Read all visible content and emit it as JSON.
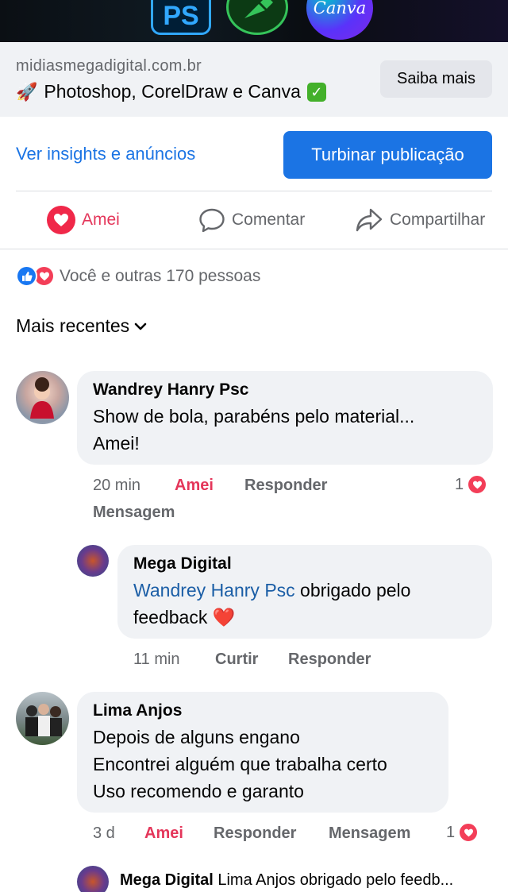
{
  "banner": {
    "app1_label": "PS",
    "app3_label": "Canva"
  },
  "link_preview": {
    "domain": "midiasmegadigital.com.br",
    "rocket_emoji": "🚀",
    "title": "Photoshop, CorelDraw e Canva",
    "check_emoji": "✓",
    "cta_label": "Saiba mais"
  },
  "promo": {
    "insights_label": "Ver insights e anúncios",
    "boost_label": "Turbinar publicação"
  },
  "actions": {
    "reaction_label": "Amei",
    "comment_label": "Comentar",
    "share_label": "Compartilhar"
  },
  "reactions": {
    "summary": "Você e outras 170 pessoas"
  },
  "sort": {
    "label": "Mais recentes"
  },
  "comments": [
    {
      "author": "Wandrey Hanry Psc",
      "text_line1": "Show de bola, parabéns pelo material...",
      "text_line2": "Amei!",
      "time": "20 min",
      "reaction": "Amei",
      "reply": "Responder",
      "message": "Mensagem",
      "reaction_count": "1",
      "replies": [
        {
          "author": "Mega Digital",
          "mention": "Wandrey Hanry Psc",
          "text_after_mention": " obrigado pelo",
          "text_line2": "feedback",
          "heart_emoji": "❤️",
          "time": "11 min",
          "like": "Curtir",
          "reply": "Responder"
        }
      ]
    },
    {
      "author": "Lima Anjos",
      "text_line1": "Depois de alguns engano",
      "text_line2": "Encontrei alguém que trabalha certo",
      "text_line3": "Uso recomendo e garanto",
      "time": "3 d",
      "reaction": "Amei",
      "reply": "Responder",
      "message": "Mensagem",
      "reaction_count": "1",
      "replies": [
        {
          "author": "Mega Digital",
          "preview": "Lima Anjos obrigado pelo feedb..."
        }
      ]
    }
  ],
  "colors": {
    "accent_blue": "#1b74e4",
    "love_red": "#e4365a",
    "bubble_grey": "#f0f2f5",
    "muted_text": "#65676b"
  }
}
